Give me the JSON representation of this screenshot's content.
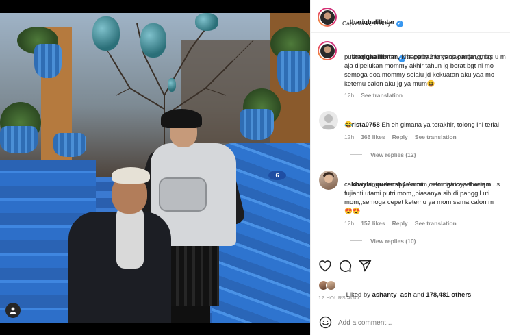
{
  "post": {
    "username": "thariqhalilintar",
    "location": "Capadocia, Turkey",
    "caption_lines": [
      "happpy mums day mom, miss u m",
      "pulang yaa momm, kita cerita2 lg yang panjang, pg",
      "aja dipelukan mommy akhir tahun lg berat bgt ni mo",
      "semoga doa mommy selalu jd kekuatan aku yaa mo",
      "ketemu calon aku jg ya mum😆"
    ],
    "caption_time": "12h",
    "caption_see_translation": "See translation",
    "plaque_number": "6"
  },
  "comments": [
    {
      "username": "rista0758",
      "lines": [
        "Eh eh gimana ya terakhir, tolong ini terlal",
        "😂"
      ],
      "time": "12h",
      "likes": "366 likes",
      "reply": "Reply",
      "see_translation": "See translation",
      "view_replies": "View replies (12)"
    },
    {
      "username": "khayla_queensh4",
      "lines": [
        "Aamiin..semoga cepet ketemu s",
        "calon istrinya thariq ya mom,,calon istrinya thariq n",
        "fujianti utami putri mom,,biasanya sih di panggil uti",
        "mom,,semoga cepet ketemu ya mom sama calon m",
        "😍😍"
      ],
      "time": "12h",
      "likes": "157 likes",
      "reply": "Reply",
      "see_translation": "See translation",
      "view_replies": "View replies (10)"
    }
  ],
  "likes": {
    "prefix": "Liked by",
    "user": "ashanty_ash",
    "middle": "and",
    "count": "178,481 others"
  },
  "timestamp": "12 HOURS AGO",
  "add_comment": {
    "placeholder": "Add a comment..."
  },
  "icons": {
    "like": "heart-icon",
    "comment": "comment-bubble-icon",
    "share": "paper-plane-icon",
    "emoji": "smiley-emoji-icon",
    "verified": "verified-badge-icon",
    "user_tag": "user-tag-icon"
  },
  "colors": {
    "verified": "#3897f0",
    "muted_text": "#8e8e8e",
    "story_ring_start": "#f9b233",
    "story_ring_end": "#c13584"
  }
}
